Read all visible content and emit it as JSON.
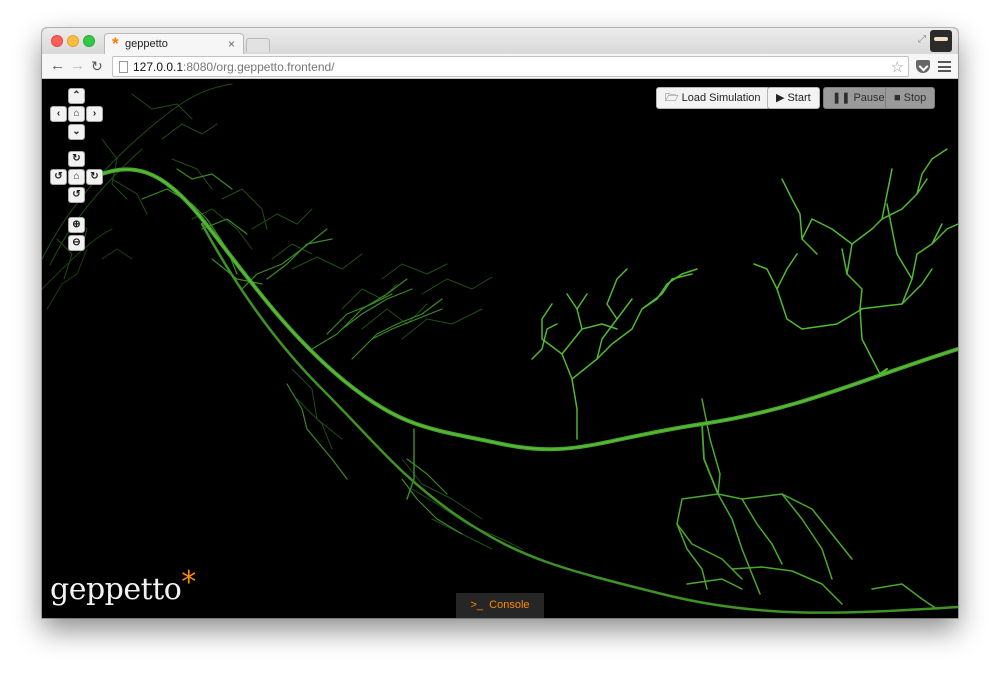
{
  "browser": {
    "tab_title": "geppetto",
    "tab_close": "×",
    "url_host": "127.0.0.1",
    "url_path": ":8080/org.geppetto.frontend/"
  },
  "camera_controls": {
    "pan_up": "⌃",
    "pan_left": "‹",
    "pan_home": "⌂",
    "pan_right": "›",
    "pan_down": "⌄",
    "rotate_up": "↻",
    "rotate_left": "↺",
    "rotate_home": "⌂",
    "rotate_right": "↻",
    "rotate_down": "↺",
    "zoom_in": "⊕",
    "zoom_out": "⊖"
  },
  "simulation_controls": {
    "load_label": "Load Simulation",
    "start_label": "Start",
    "pause_label": "Pause",
    "stop_label": "Stop"
  },
  "logo": {
    "text": "geppetto",
    "asterisk": "*"
  },
  "console": {
    "label": "Console"
  },
  "colors": {
    "accent": "#ff8a00",
    "neuron": "#4caf2e",
    "background": "#000000"
  }
}
